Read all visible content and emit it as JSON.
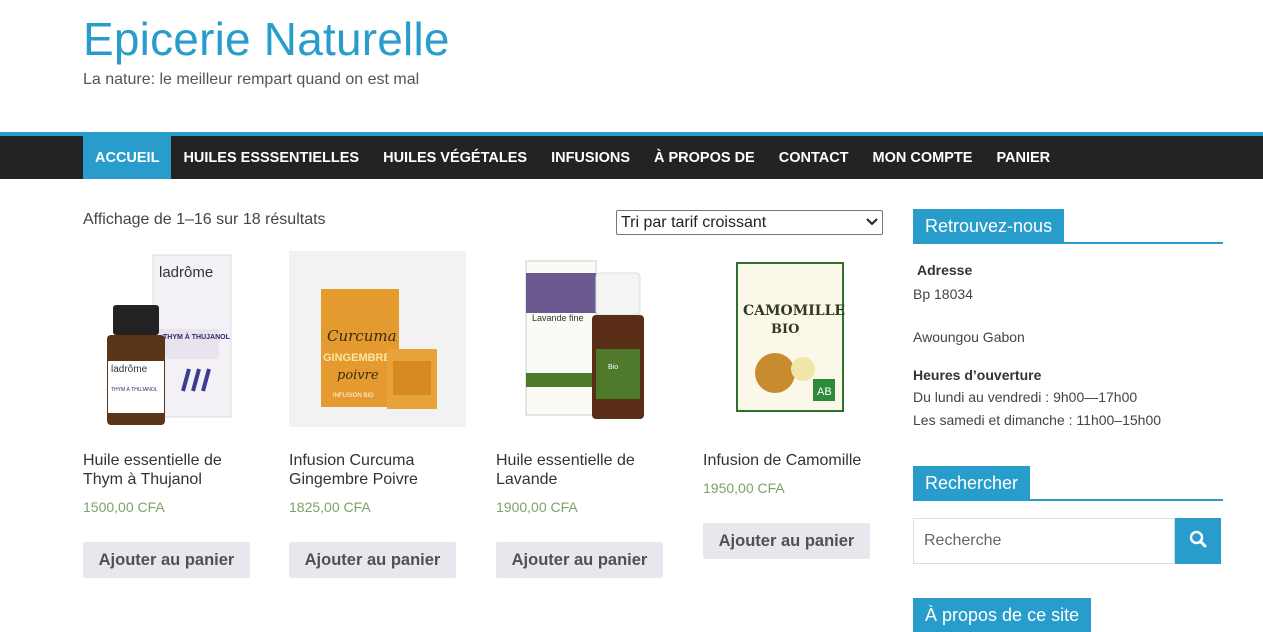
{
  "site": {
    "title": "Epicerie Naturelle",
    "tagline": "La nature: le meilleur rempart quand on est mal"
  },
  "nav": {
    "items": [
      "ACCUEIL",
      "HUILES ESSSENTIELLES",
      "HUILES VÉGÉTALES",
      "INFUSIONS",
      "À PROPOS DE",
      "CONTACT",
      "MON COMPTE",
      "PANIER"
    ],
    "active_index": 0
  },
  "shop": {
    "result_count": "Affichage de 1–16 sur 18 résultats",
    "sort_selected": "Tri par tarif croissant",
    "add_to_cart_label": "Ajouter au panier",
    "products": [
      {
        "title": "Huile essentielle de Thym à Thujanol",
        "price": "1500,00 CFA",
        "image_text": [
          "ladrôme",
          "THYM À THUJANOL",
          "ladrôme",
          "THYM À THUJANOL"
        ]
      },
      {
        "title": "Infusion Curcuma Gingembre Poivre",
        "price": "1825,00 CFA",
        "image_text": [
          "Curcuma",
          "GINGEMBRE",
          "poivre",
          "INFUSION BIO"
        ]
      },
      {
        "title": "Huile essentielle de Lavande",
        "price": "1900,00 CFA",
        "image_text": [
          "Lavande fine",
          "Bio"
        ]
      },
      {
        "title": "Infusion de Camomille",
        "price": "1950,00 CFA",
        "image_text": [
          "CAMOMILLE",
          "BIO",
          "AB"
        ]
      }
    ]
  },
  "sidebar": {
    "contact_widget": {
      "title": "Retrouvez-nous",
      "address_label": "Adresse",
      "address_line1": "Bp 18034",
      "address_line2": "Awoungou Gabon",
      "hours_label": "Heures d’ouverture",
      "hours_line1": "Du lundi au vendredi : 9h00—17h00",
      "hours_line2": "Les samedi et dimanche : 11h00–15h00"
    },
    "search_widget": {
      "title": "Rechercher",
      "placeholder": "Recherche"
    },
    "about_widget": {
      "title": "À propos de ce site"
    }
  },
  "colors": {
    "accent": "#289dcc",
    "nav_bg": "#232323",
    "price": "#7ba468",
    "button_bg": "#e9e6ed"
  }
}
